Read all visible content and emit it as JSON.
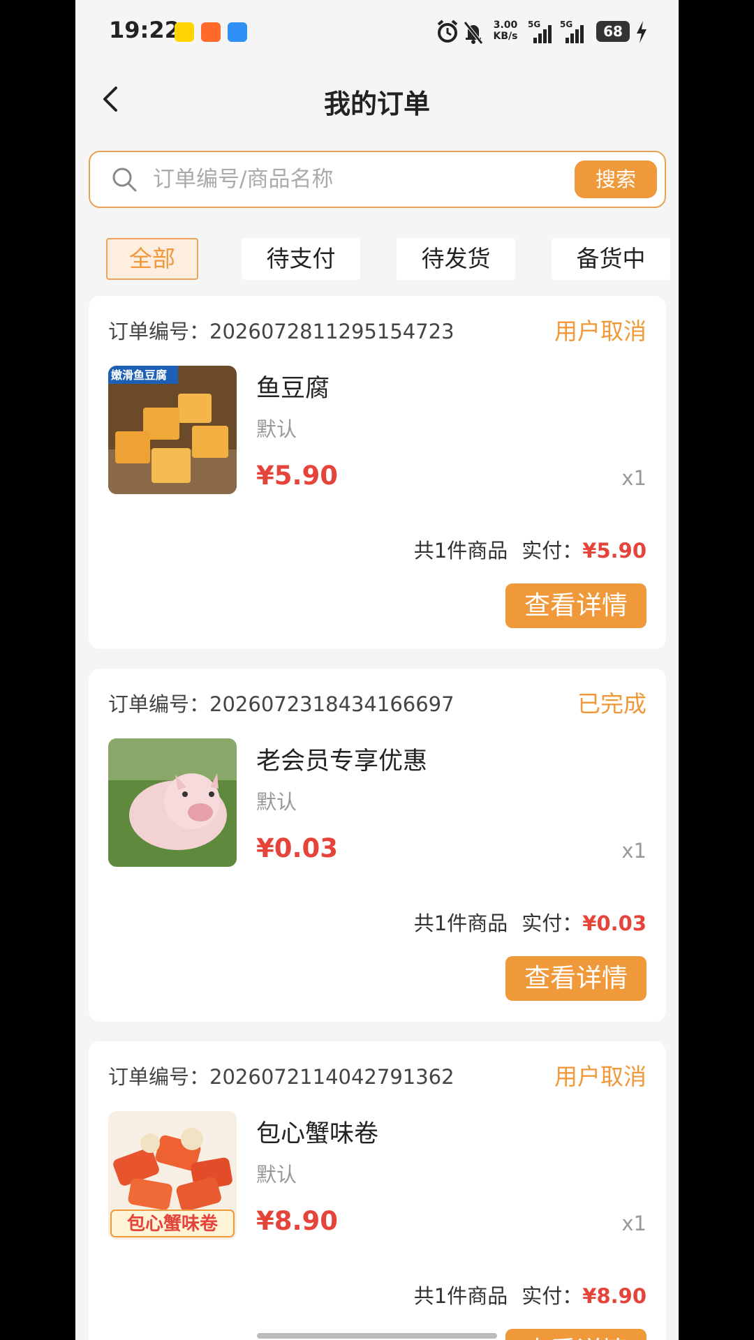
{
  "status_bar": {
    "time": "19:22",
    "net_speed_value": "3.00",
    "net_speed_unit": "KB/s",
    "signal1": "5G",
    "signal2": "5G",
    "battery": "68"
  },
  "header": {
    "title": "我的订单"
  },
  "search": {
    "placeholder": "订单编号/商品名称",
    "button_label": "搜索"
  },
  "tabs": [
    {
      "label": "全部",
      "active": true
    },
    {
      "label": "待支付",
      "active": false
    },
    {
      "label": "待发货",
      "active": false
    },
    {
      "label": "备货中",
      "active": false
    }
  ],
  "labels": {
    "order_no_prefix": "订单编号：",
    "paid_prefix": "实付：",
    "detail_button": "查看详情"
  },
  "orders": [
    {
      "order_no": "2026072811295154723",
      "status": "用户取消",
      "product_name": "鱼豆腐",
      "spec": "默认",
      "price": "¥5.90",
      "qty": "x1",
      "item_count": "共1件商品",
      "paid": "¥5.90",
      "thumb_text": "嫩滑鱼豆腐"
    },
    {
      "order_no": "2026072318434166697",
      "status": "已完成",
      "product_name": "老会员专享优惠",
      "spec": "默认",
      "price": "¥0.03",
      "qty": "x1",
      "item_count": "共1件商品",
      "paid": "¥0.03"
    },
    {
      "order_no": "2026072114042791362",
      "status": "用户取消",
      "product_name": "包心蟹味卷",
      "spec": "默认",
      "price": "¥8.90",
      "qty": "x1",
      "item_count": "共1件商品",
      "paid": "¥8.90",
      "thumb_text": "包心蟹味卷"
    }
  ],
  "colors": {
    "accent": "#f0993a",
    "price": "#e5443a",
    "background": "#f5f5f5"
  }
}
